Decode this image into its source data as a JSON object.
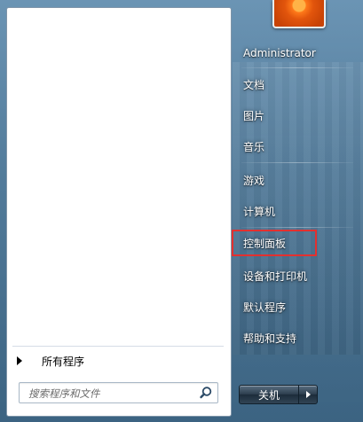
{
  "left_pane": {
    "all_programs_label": "所有程序",
    "search": {
      "placeholder": "搜索程序和文件"
    }
  },
  "right_pane": {
    "items": [
      {
        "label": "Administrator"
      },
      {
        "label": "文档"
      },
      {
        "label": "图片"
      },
      {
        "label": "音乐"
      },
      {
        "label": "游戏"
      },
      {
        "label": "计算机"
      },
      {
        "label": "控制面板"
      },
      {
        "label": "设备和打印机"
      },
      {
        "label": "默认程序"
      },
      {
        "label": "帮助和支持"
      }
    ],
    "highlighted_item": "控制面板",
    "highlight_color": "#e3302f"
  },
  "shutdown": {
    "label": "关机"
  },
  "icons": {
    "search": "search-icon",
    "all_programs_arrow": "right-triangle-icon",
    "shutdown_options": "right-triangle-icon",
    "avatar": "flower-avatar"
  }
}
